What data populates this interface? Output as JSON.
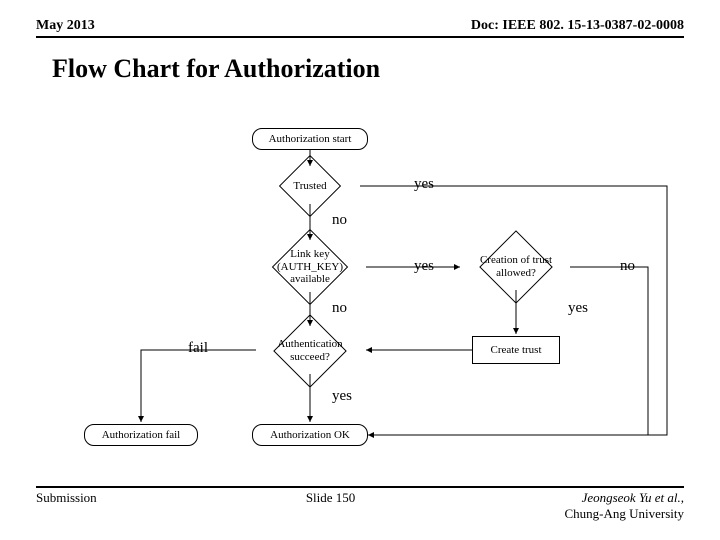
{
  "header": {
    "left": "May 2013",
    "right": "Doc: IEEE 802. 15-13-0387-02-0008"
  },
  "title": "Flow Chart for Authorization",
  "nodes": {
    "start": "Authorization start",
    "trusted": "Trusted",
    "linkkey": "Link key (AUTH_KEY) available",
    "authsucceed": "Authentication succeed?",
    "trustallowed": "Creation of trust allowed?",
    "createtrust": "Create trust",
    "authfail": "Authorization fail",
    "authok": "Authorization OK"
  },
  "labels": {
    "yes": "yes",
    "no": "no",
    "fail": "fail"
  },
  "footer": {
    "left": "Submission",
    "center": "Slide 150",
    "rightLine1": "Jeongseok Yu et al.,",
    "rightLine2": "Chung-Ang University"
  }
}
